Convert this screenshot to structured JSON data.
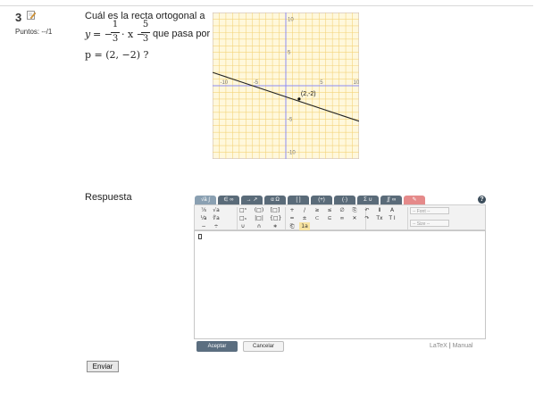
{
  "question": {
    "number": "3",
    "points_label": "Puntos: --/1",
    "text": "Cuál es la recta ortogonal a",
    "formula": {
      "lhs": "y",
      "eq": "= −",
      "frac1_num": "1",
      "frac1_den": "3",
      "mid": "· x −",
      "frac2_num": "5",
      "frac2_den": "3"
    },
    "tail": "que pasa por",
    "point_text": "p = (2, −2) ?"
  },
  "graph": {
    "x_ticks": [
      "-10",
      "-5",
      "5",
      "10"
    ],
    "y_ticks": [
      "10",
      "5",
      "-5",
      "-10"
    ],
    "point_label": "(2,-2)",
    "colors": {
      "grid": "#f3d37a",
      "background": "#fff8dc",
      "axes": "#8c8cf5",
      "line": "#222222"
    },
    "line": {
      "slope": -0.3333,
      "intercept": -1.6667
    },
    "point": {
      "x": 2,
      "y": -2
    },
    "range": [
      -11,
      11
    ]
  },
  "answer": {
    "label": "Respuesta",
    "tabs": [
      "√ā ∫",
      "∈ ∞",
      "→ ↗",
      "α Ω",
      "[ ]",
      "(+)",
      "(·)",
      "Σ ∪",
      "∬ ∞",
      "✎"
    ],
    "tools": [
      "⅞",
      "√a",
      "□ⁿ",
      "(□)",
      "[□]",
      "+",
      "/",
      "≥",
      "≤",
      "∅",
      "⎘",
      "↶",
      "Ⅱ",
      "A",
      "⅟a",
      "∜a",
      "□ₙ",
      "|□|",
      "{□}",
      "=",
      "±",
      "⊂",
      "⊆",
      "∞",
      "✕",
      "↷",
      "Tx",
      "T I",
      "−",
      "÷",
      "∪",
      "∩",
      "∗",
      "⎗",
      "1a"
    ],
    "font_select": "-- Font --",
    "size_select": "-- Size --",
    "accept_label": "Aceptar",
    "cancel_label": "Cancelar",
    "latex_link": "LaTeX",
    "manual_link": "Manual",
    "separator": "|"
  },
  "submit_label": "Enviar"
}
